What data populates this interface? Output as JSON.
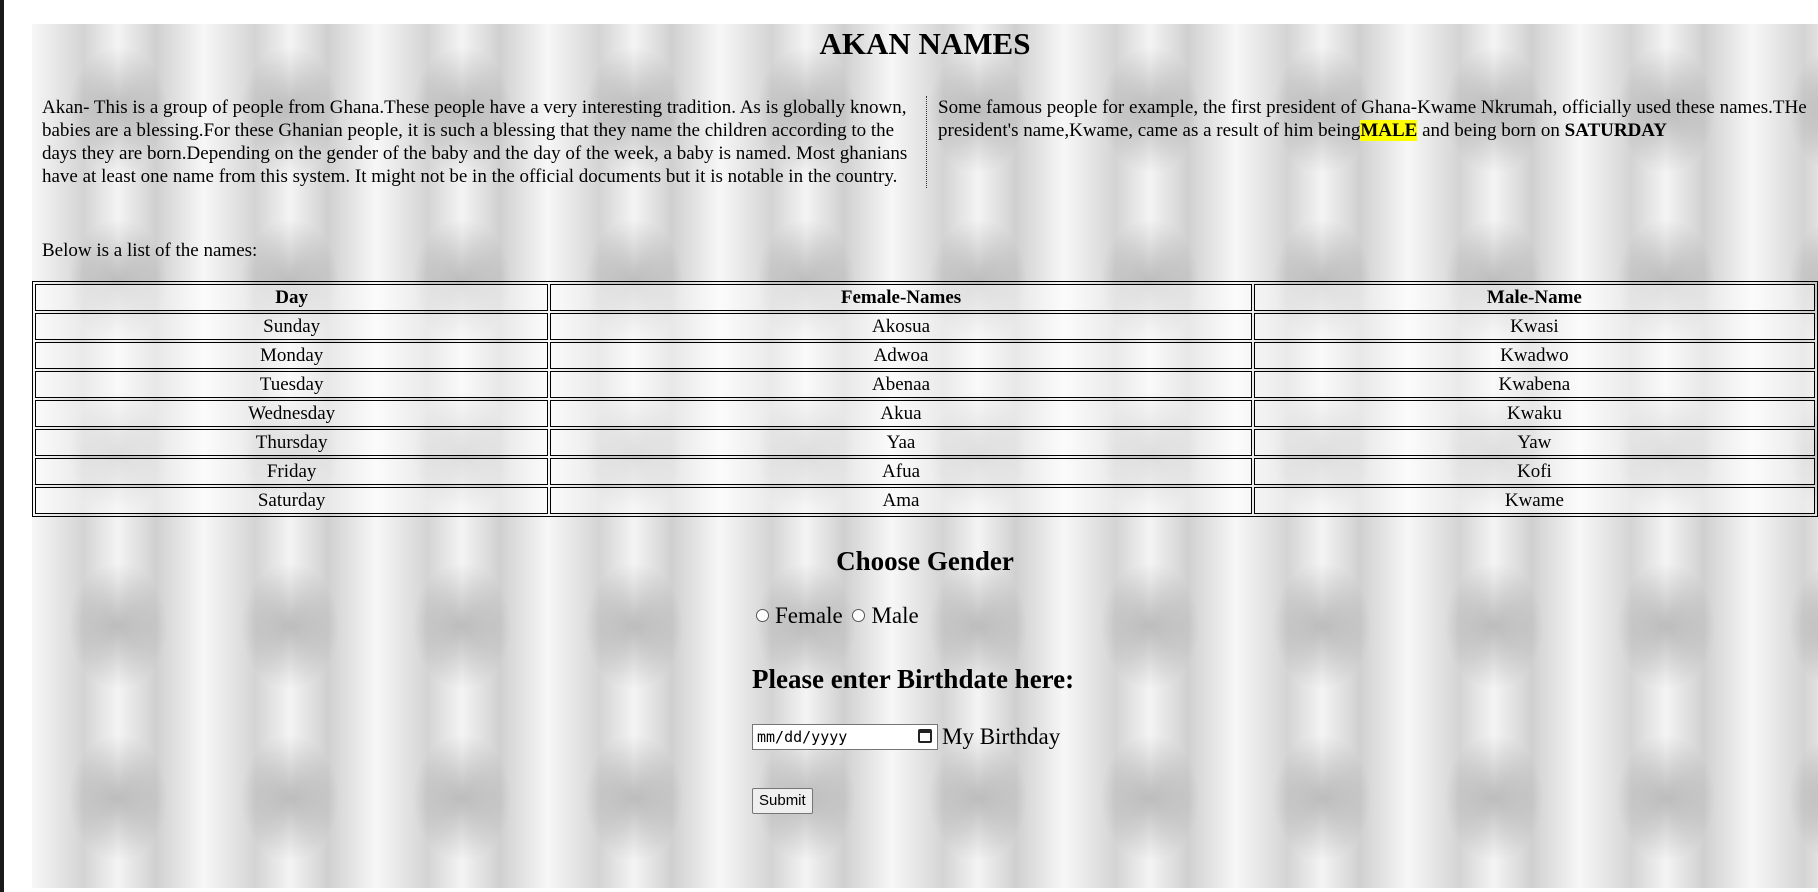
{
  "page": {
    "title": "AKAN NAMES",
    "intro": {
      "text": "Akan- This is a group of people from Ghana.These people have a very interesting tradition. As is globally known, babies are a blessing.For these Ghanian people, it is such a blessing that they name the children according to the days they are born.Depending on the gender of the baby and the day of the week, a baby is named. Most ghanians have at least one name from this system. It might not be in the official documents but it is notable in the country. Some famous people for example, the first president of Ghana-Kwame Nkrumah, officially used these names.THe president's name,Kwame, came as a result of him being",
      "highlight": "MALE",
      "after": " and being born on ",
      "bold": "SATURDAY"
    },
    "list_intro": "Below is a list of the names:"
  },
  "table": {
    "headers": [
      "Day",
      "Female-Names",
      "Male-Name"
    ],
    "rows": [
      [
        "Sunday",
        "Akosua",
        "Kwasi"
      ],
      [
        "Monday",
        "Adwoa",
        "Kwadwo"
      ],
      [
        "Tuesday",
        "Abenaa",
        "Kwabena"
      ],
      [
        "Wednesday",
        "Akua",
        "Kwaku"
      ],
      [
        "Thursday",
        "Yaa",
        "Yaw"
      ],
      [
        "Friday",
        "Afua",
        "Kofi"
      ],
      [
        "Saturday",
        "Ama",
        "Kwame"
      ]
    ]
  },
  "form": {
    "gender_title": "Choose Gender",
    "female_label": "Female",
    "male_label": "Male",
    "birth_title": "Please enter Birthdate here:",
    "date_placeholder": "mm/dd/yyyy",
    "date_label": "My Birthday",
    "submit_label": "Submit"
  },
  "colors": {
    "highlight": "#ffff00"
  }
}
